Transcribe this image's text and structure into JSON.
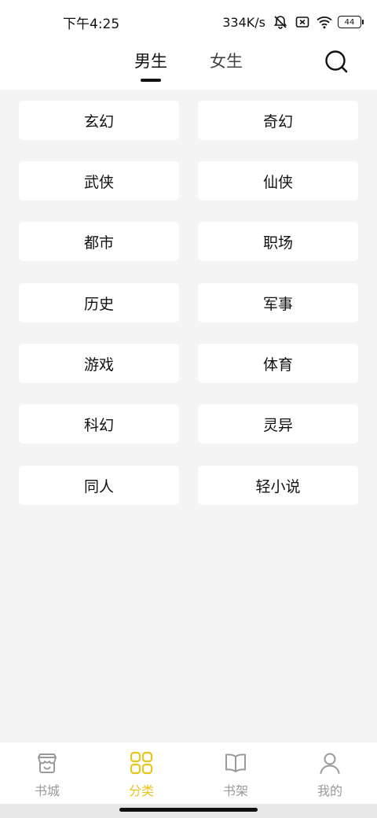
{
  "status": {
    "time": "下午4:25",
    "net_speed": "334K/s",
    "battery": "44"
  },
  "tabs": [
    {
      "label": "男生",
      "active": true
    },
    {
      "label": "女生",
      "active": false
    }
  ],
  "categories": [
    "玄幻",
    "奇幻",
    "武侠",
    "仙侠",
    "都市",
    "职场",
    "历史",
    "军事",
    "游戏",
    "体育",
    "科幻",
    "灵异",
    "同人",
    "轻小说"
  ],
  "nav": [
    {
      "label": "书城",
      "icon": "store-icon",
      "active": false
    },
    {
      "label": "分类",
      "icon": "grid-icon",
      "active": true
    },
    {
      "label": "书架",
      "icon": "book-icon",
      "active": false
    },
    {
      "label": "我的",
      "icon": "user-icon",
      "active": false
    }
  ],
  "colors": {
    "accent": "#e9c51c",
    "inactive": "#9a9a9a",
    "background": "#f4f4f4"
  }
}
